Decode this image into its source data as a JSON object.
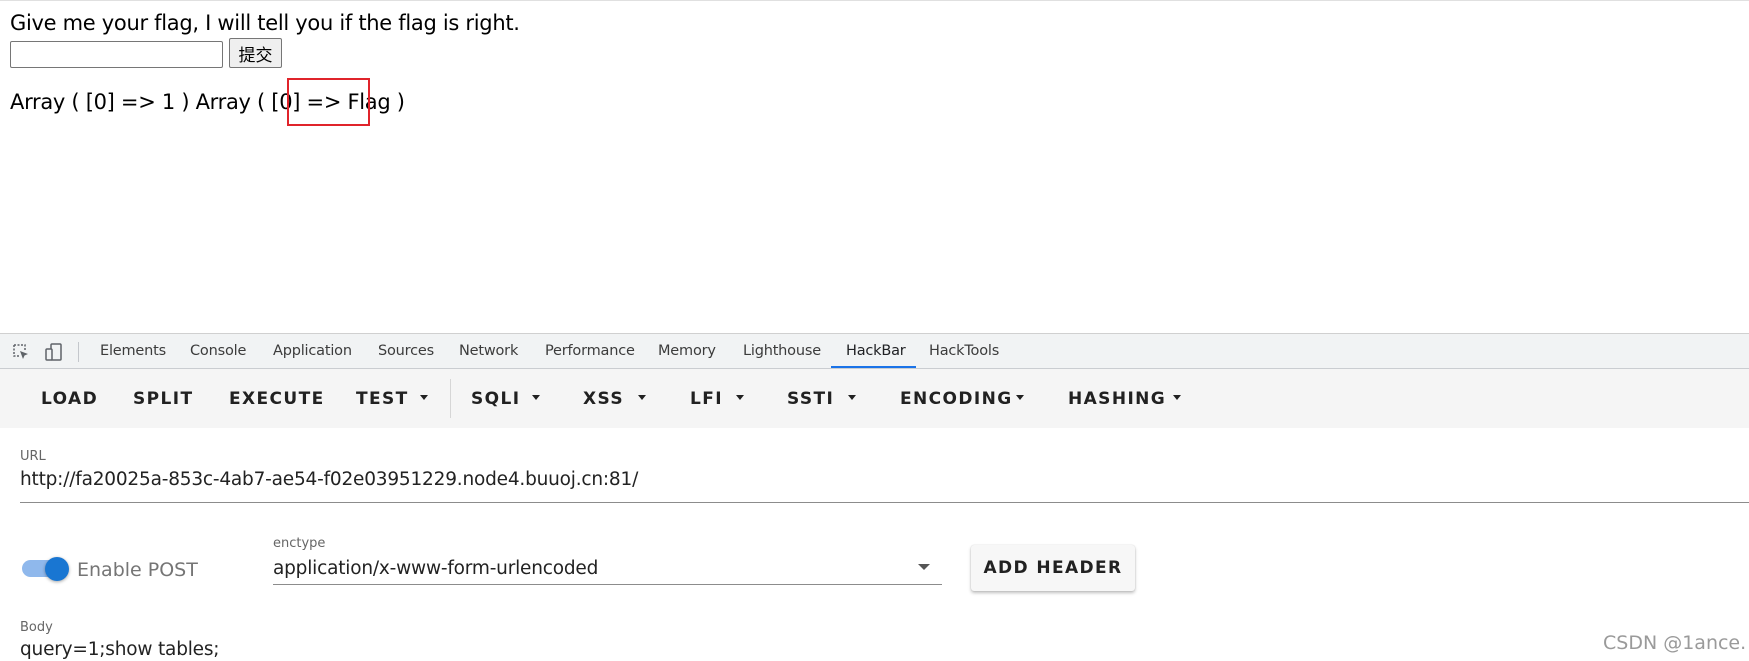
{
  "page": {
    "prompt": "Give me your flag, I will tell you if the flag is right.",
    "input_value": "",
    "submit_label": "提交",
    "result": "Array ( [0] => 1 ) Array ( [0] => Flag )"
  },
  "devtools": {
    "tabs": [
      "Elements",
      "Console",
      "Application",
      "Sources",
      "Network",
      "Performance",
      "Memory",
      "Lighthouse",
      "HackBar",
      "HackTools"
    ],
    "active_tab": "HackBar",
    "icons": [
      "inspect-element-icon",
      "device-toolbar-icon"
    ]
  },
  "hackbar": {
    "toolbar": {
      "load": "LOAD",
      "split": "SPLIT",
      "execute": "EXECUTE",
      "test": "TEST",
      "sqli": "SQLI",
      "xss": "XSS",
      "lfi": "LFI",
      "ssti": "SSTI",
      "encoding": "ENCODING",
      "hashing": "HASHING"
    },
    "url_label": "URL",
    "url": "http://fa20025a-853c-4ab7-ae54-f02e03951229.node4.buuoj.cn:81/",
    "enable_post_label": "Enable POST",
    "enable_post": true,
    "enctype_label": "enctype",
    "enctype": "application/x-www-form-urlencoded",
    "add_header_label": "ADD HEADER",
    "body_label": "Body",
    "body": "query=1;show tables;"
  },
  "watermark": "CSDN @1ance.",
  "colors": {
    "highlight_box": "#e0242b",
    "active_tab_underline": "#1a73e8",
    "toggle_knob": "#1976d2",
    "toggle_track": "#8fb8ec"
  }
}
